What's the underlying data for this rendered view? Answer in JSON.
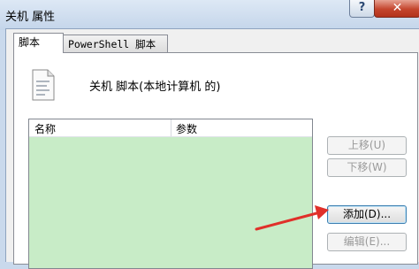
{
  "window": {
    "title": "关机 属性",
    "help_label": "?",
    "close_label": "✕"
  },
  "tabs": [
    {
      "label": "脚本",
      "active": true
    },
    {
      "label": "PowerShell 脚本",
      "active": false
    }
  ],
  "panel": {
    "icon": "script-file-icon",
    "heading": "关机 脚本(本地计算机 的)"
  },
  "list": {
    "columns": [
      "名称",
      "参数"
    ],
    "rows": [],
    "background": "#c8ecc7"
  },
  "buttons": {
    "move_up": "上移(U)",
    "move_down": "下移(W)",
    "add": "添加(D)...",
    "edit": "编辑(E)..."
  },
  "annotation": {
    "arrow_color": "#e0302a",
    "arrow_icon": "red-arrow-icon"
  }
}
